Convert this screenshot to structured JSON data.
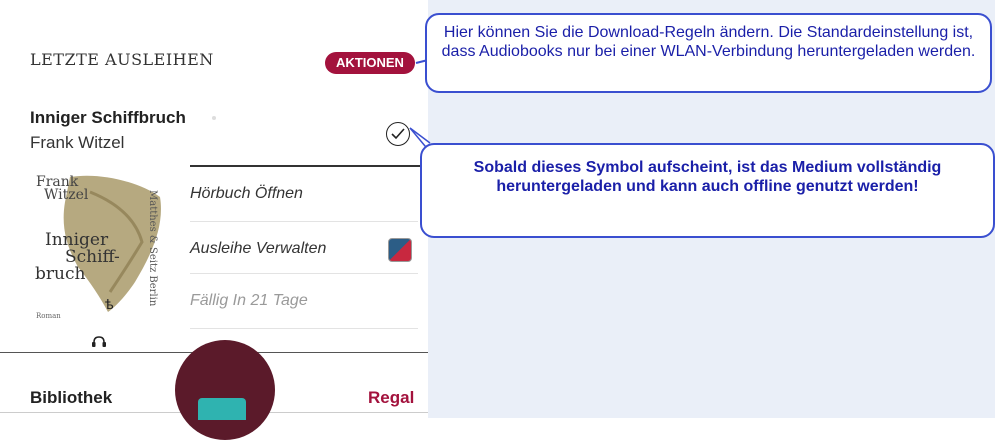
{
  "panel": {
    "section_title": "LETZTE AUSLEIHEN",
    "actions_label": "AKTIONEN",
    "book": {
      "title": "Inniger Schiffbruch",
      "author": "Frank Witzel"
    },
    "cover": {
      "author_line1": "Frank",
      "author_line2": "Witzel",
      "title_line1": "Inniger",
      "title_line2": "Schiff-",
      "title_line3": "bruch",
      "publisher": "Matthes & Seitz Berlin",
      "genre": "Roman"
    },
    "menu": {
      "open_label": "Hörbuch Öffnen",
      "manage_label": "Ausleihe Verwalten",
      "due_label": "Fällig In 21 Tage"
    },
    "tabs": {
      "library_label": "Bibliothek",
      "shelf_label": "Regal"
    }
  },
  "callouts": {
    "download_rules": "Hier können Sie die Download-Regeln ändern. Die Standardeinstellung ist, dass Audiobooks nur bei einer WLAN-Verbindung heruntergeladen werden.",
    "offline_symbol": "Sobald dieses Symbol aufscheint, ist das Medium vollständig heruntergeladen und kann auch offline genutzt werden!"
  },
  "icons": {
    "downloaded": "check-circle-icon",
    "manage": "loan-manage-icon",
    "audio": "headphones-icon",
    "center": "open-book-icon"
  },
  "colors": {
    "accent": "#a3123d",
    "callout_border": "#3a4fd0",
    "callout_text": "#1a1fa8",
    "center_button": "#5b1a2a"
  }
}
